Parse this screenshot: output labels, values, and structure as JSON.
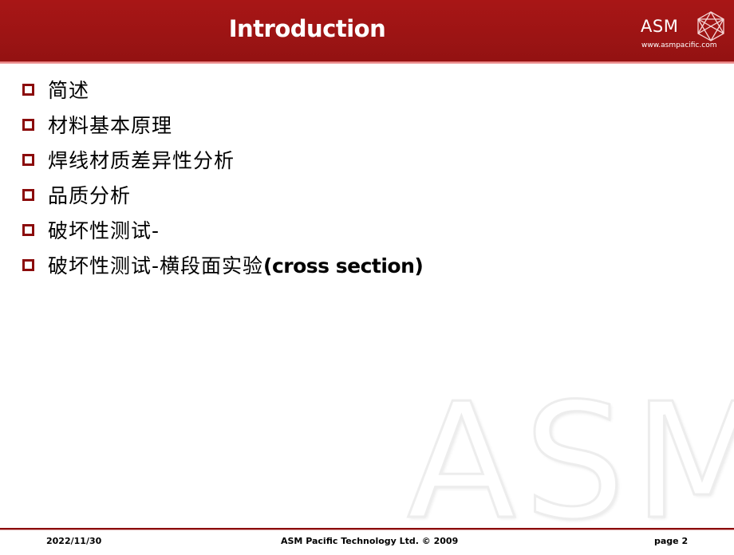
{
  "header": {
    "title": "Introduction",
    "logo_text": "ASM",
    "logo_url": "www.asmpacific.com",
    "accent_color": "#9c1414"
  },
  "bullets": [
    {
      "text": "简述",
      "suffix": ""
    },
    {
      "text": "材料基本原理",
      "suffix": ""
    },
    {
      "text": "焊线材质差异性分析",
      "suffix": ""
    },
    {
      "text": "品质分析",
      "suffix": ""
    },
    {
      "text": "破坏性测试-",
      "suffix": ""
    },
    {
      "text": "破坏性测试-横段面实验",
      "suffix": "(cross section)"
    }
  ],
  "watermark": "ASM",
  "footer": {
    "date": "2022/11/30",
    "company": "ASM Pacific Technology Ltd. © 2009",
    "page": "page 2"
  }
}
